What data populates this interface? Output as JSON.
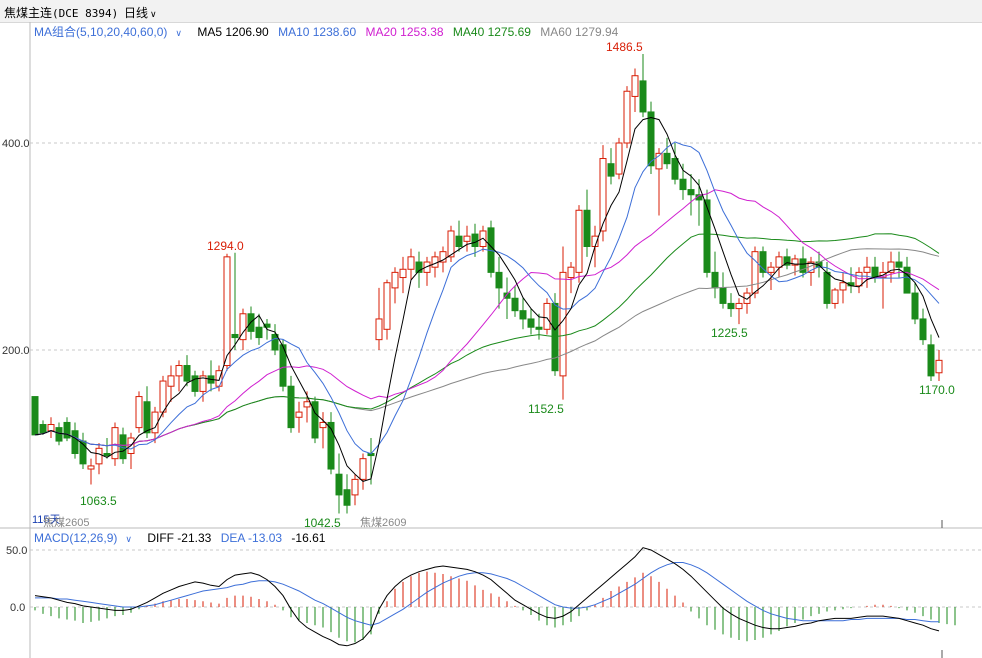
{
  "title_bar": {
    "symbol": "焦煤主连",
    "code": "(DCE 8394)",
    "period": "日线"
  },
  "ma_legend": {
    "group": "MA组合(5,10,20,40,60,0)",
    "ma5": "MA5 1206.90",
    "ma10": "MA10 1238.60",
    "ma20": "MA20 1253.38",
    "ma40": "MA40 1275.69",
    "ma60": "MA60 1279.94"
  },
  "macd_legend": {
    "group": "MACD(12,26,9)",
    "diff": "DIFF -21.33",
    "dea": "DEA -13.03",
    "macd": "-16.61"
  },
  "price_axis": {
    "label_1400": "400.0",
    "label_1200": "200.0"
  },
  "macd_axis": {
    "label_50": "50.0",
    "label_0": "0.0"
  },
  "contract_labels": {
    "left_prefix": "115天",
    "left": "焦煤2605",
    "right": "焦煤2609"
  },
  "annotations": {
    "high": "1486.5",
    "p1294": "1294.0",
    "p1063": "1063.5",
    "p1042": "1042.5",
    "p1152": "1152.5",
    "p1225": "1225.5",
    "p1170": "1170.0"
  },
  "colors": {
    "up": "#d81e06",
    "down": "#1a8a1a",
    "ma5": "#000000",
    "ma10": "#3d6fd8",
    "ma20": "#d020d0",
    "ma40": "#1a8a1a",
    "ma60": "#888888",
    "blue_text": "#3d6fd8"
  },
  "icons": {
    "dropdown": "chevron-down-icon"
  },
  "chart_data": {
    "type": "candlestick",
    "note": "Daily candles, approximate OHLC read from the chart",
    "ylim": [
      1030,
      1500
    ],
    "candles": [
      [
        1155,
        1150,
        1120,
        1118
      ],
      [
        1128,
        1132,
        1118,
        1120
      ],
      [
        1122,
        1135,
        1115,
        1128
      ],
      [
        1125,
        1130,
        1108,
        1112
      ],
      [
        1130,
        1135,
        1112,
        1115
      ],
      [
        1122,
        1130,
        1095,
        1100
      ],
      [
        1112,
        1120,
        1085,
        1090
      ],
      [
        1085,
        1095,
        1070,
        1088
      ],
      [
        1090,
        1110,
        1080,
        1105
      ],
      [
        1100,
        1115,
        1095,
        1098
      ],
      [
        1095,
        1130,
        1088,
        1125
      ],
      [
        1118,
        1125,
        1090,
        1095
      ],
      [
        1100,
        1120,
        1085,
        1115
      ],
      [
        1125,
        1160,
        1120,
        1155
      ],
      [
        1150,
        1165,
        1115,
        1120
      ],
      [
        1120,
        1145,
        1110,
        1140
      ],
      [
        1140,
        1175,
        1135,
        1170
      ],
      [
        1165,
        1185,
        1150,
        1175
      ],
      [
        1175,
        1190,
        1160,
        1185
      ],
      [
        1185,
        1195,
        1165,
        1170
      ],
      [
        1175,
        1180,
        1155,
        1160
      ],
      [
        1160,
        1180,
        1150,
        1175
      ],
      [
        1175,
        1190,
        1160,
        1168
      ],
      [
        1165,
        1185,
        1160,
        1180
      ],
      [
        1185,
        1293,
        1180,
        1290
      ],
      [
        1215,
        1294,
        1200,
        1212
      ],
      [
        1210,
        1240,
        1200,
        1235
      ],
      [
        1235,
        1242,
        1210,
        1218
      ],
      [
        1222,
        1235,
        1205,
        1212
      ],
      [
        1225,
        1230,
        1210,
        1222
      ],
      [
        1215,
        1225,
        1195,
        1200
      ],
      [
        1205,
        1210,
        1160,
        1165
      ],
      [
        1165,
        1175,
        1120,
        1125
      ],
      [
        1135,
        1150,
        1120,
        1140
      ],
      [
        1145,
        1160,
        1130,
        1150
      ],
      [
        1150,
        1155,
        1110,
        1115
      ],
      [
        1125,
        1140,
        1105,
        1130
      ],
      [
        1130,
        1140,
        1080,
        1085
      ],
      [
        1080,
        1100,
        1042,
        1060
      ],
      [
        1065,
        1080,
        1042,
        1050
      ],
      [
        1060,
        1080,
        1050,
        1075
      ],
      [
        1075,
        1100,
        1065,
        1095
      ],
      [
        1100,
        1115,
        1070,
        1098
      ],
      [
        1210,
        1260,
        1200,
        1230
      ],
      [
        1220,
        1268,
        1210,
        1265
      ],
      [
        1260,
        1280,
        1245,
        1275
      ],
      [
        1270,
        1290,
        1255,
        1278
      ],
      [
        1278,
        1298,
        1268,
        1290
      ],
      [
        1285,
        1295,
        1260,
        1275
      ],
      [
        1275,
        1290,
        1262,
        1285
      ],
      [
        1280,
        1295,
        1270,
        1290
      ],
      [
        1285,
        1300,
        1275,
        1295
      ],
      [
        1290,
        1320,
        1285,
        1315
      ],
      [
        1310,
        1325,
        1295,
        1300
      ],
      [
        1305,
        1320,
        1295,
        1310
      ],
      [
        1312,
        1322,
        1290,
        1300
      ],
      [
        1300,
        1320,
        1295,
        1315
      ],
      [
        1318,
        1325,
        1270,
        1275
      ],
      [
        1275,
        1290,
        1240,
        1260
      ],
      [
        1255,
        1270,
        1230,
        1250
      ],
      [
        1250,
        1262,
        1232,
        1238
      ],
      [
        1238,
        1250,
        1220,
        1230
      ],
      [
        1230,
        1240,
        1215,
        1222
      ],
      [
        1222,
        1235,
        1210,
        1220
      ],
      [
        1220,
        1250,
        1215,
        1245
      ],
      [
        1245,
        1255,
        1175,
        1180
      ],
      [
        1175,
        1300,
        1152,
        1275
      ],
      [
        1270,
        1285,
        1255,
        1280
      ],
      [
        1275,
        1340,
        1265,
        1335
      ],
      [
        1335,
        1355,
        1290,
        1300
      ],
      [
        1300,
        1320,
        1280,
        1310
      ],
      [
        1315,
        1398,
        1305,
        1385
      ],
      [
        1380,
        1395,
        1360,
        1368
      ],
      [
        1370,
        1405,
        1365,
        1400
      ],
      [
        1400,
        1455,
        1395,
        1450
      ],
      [
        1445,
        1472,
        1430,
        1465
      ],
      [
        1460,
        1486,
        1425,
        1430
      ],
      [
        1430,
        1440,
        1370,
        1378
      ],
      [
        1375,
        1395,
        1330,
        1390
      ],
      [
        1390,
        1405,
        1375,
        1380
      ],
      [
        1385,
        1400,
        1360,
        1365
      ],
      [
        1365,
        1380,
        1345,
        1355
      ],
      [
        1355,
        1370,
        1330,
        1350
      ],
      [
        1350,
        1365,
        1320,
        1345
      ],
      [
        1345,
        1355,
        1270,
        1275
      ],
      [
        1275,
        1295,
        1250,
        1260
      ],
      [
        1260,
        1275,
        1240,
        1245
      ],
      [
        1245,
        1255,
        1232,
        1240
      ],
      [
        1240,
        1250,
        1225,
        1245
      ],
      [
        1245,
        1260,
        1235,
        1255
      ],
      [
        1255,
        1300,
        1250,
        1295
      ],
      [
        1295,
        1300,
        1270,
        1275
      ],
      [
        1275,
        1285,
        1258,
        1280
      ],
      [
        1280,
        1295,
        1270,
        1290
      ],
      [
        1290,
        1298,
        1278,
        1282
      ],
      [
        1282,
        1292,
        1272,
        1288
      ],
      [
        1288,
        1300,
        1270,
        1275
      ],
      [
        1275,
        1290,
        1262,
        1285
      ],
      [
        1285,
        1295,
        1270,
        1280
      ],
      [
        1275,
        1285,
        1240,
        1245
      ],
      [
        1245,
        1260,
        1240,
        1258
      ],
      [
        1258,
        1275,
        1245,
        1265
      ],
      [
        1265,
        1280,
        1255,
        1262
      ],
      [
        1262,
        1280,
        1255,
        1275
      ],
      [
        1275,
        1290,
        1260,
        1280
      ],
      [
        1280,
        1290,
        1265,
        1270
      ],
      [
        1270,
        1285,
        1240,
        1275
      ],
      [
        1275,
        1295,
        1265,
        1285
      ],
      [
        1285,
        1295,
        1270,
        1280
      ],
      [
        1280,
        1290,
        1260,
        1255
      ],
      [
        1255,
        1265,
        1225,
        1230
      ],
      [
        1230,
        1240,
        1205,
        1210
      ],
      [
        1205,
        1215,
        1170,
        1175
      ],
      [
        1178,
        1200,
        1170,
        1190
      ]
    ],
    "macd": {
      "ylim": [
        -45,
        60
      ],
      "hist": [
        -3,
        -6,
        -8,
        -10,
        -11,
        -12,
        -14,
        -13,
        -12,
        -10,
        -8,
        -7,
        -5,
        -2,
        1,
        3,
        5,
        6,
        7,
        7,
        6,
        5,
        4,
        3,
        8,
        10,
        10,
        9,
        7,
        5,
        2,
        -3,
        -9,
        -12,
        -14,
        -16,
        -18,
        -22,
        -27,
        -30,
        -31,
        -29,
        -24,
        -6,
        5,
        16,
        22,
        27,
        30,
        31,
        30,
        29,
        27,
        25,
        23,
        19,
        15,
        12,
        9,
        5,
        1,
        -3,
        -7,
        -12,
        -16,
        -18,
        -16,
        -13,
        -8,
        -3,
        2,
        8,
        14,
        18,
        22,
        26,
        30,
        27,
        22,
        16,
        10,
        4,
        -4,
        -10,
        -16,
        -20,
        -24,
        -27,
        -29,
        -30,
        -29,
        -27,
        -24,
        -21,
        -17,
        -14,
        -11,
        -8,
        -6,
        -4,
        -3,
        -2,
        -1,
        0,
        1,
        2,
        2,
        1,
        -1,
        -3,
        -5,
        -8,
        -11,
        -14,
        -15,
        -16
      ],
      "diff": [
        10,
        9,
        8,
        6,
        4,
        3,
        1,
        0,
        -1,
        -2,
        -3,
        -3,
        -2,
        1,
        4,
        8,
        12,
        15,
        18,
        20,
        22,
        21,
        19,
        18,
        24,
        28,
        29,
        30,
        28,
        24,
        18,
        10,
        -2,
        -12,
        -18,
        -22,
        -26,
        -29,
        -33,
        -34,
        -32,
        -28,
        -20,
        -2,
        10,
        18,
        24,
        28,
        31,
        33,
        35,
        36,
        35,
        34,
        33,
        31,
        28,
        24,
        18,
        12,
        6,
        2,
        -2,
        -6,
        -9,
        -10,
        -8,
        -4,
        2,
        8,
        14,
        20,
        26,
        32,
        38,
        44,
        52,
        50,
        46,
        42,
        38,
        33,
        27,
        20,
        13,
        6,
        -1,
        -6,
        -10,
        -13,
        -16,
        -18,
        -19,
        -19,
        -18,
        -17,
        -15,
        -14,
        -12,
        -11,
        -10,
        -10,
        -10,
        -9,
        -8,
        -8,
        -8,
        -9,
        -10,
        -12,
        -14,
        -16,
        -19,
        -21
      ],
      "dea": [
        8,
        8,
        8,
        7,
        7,
        6,
        5,
        4,
        3,
        2,
        1,
        0,
        0,
        0,
        1,
        2,
        4,
        6,
        8,
        10,
        12,
        14,
        15,
        16,
        17,
        19,
        20,
        22,
        23,
        23,
        22,
        20,
        17,
        14,
        10,
        6,
        3,
        -1,
        -5,
        -9,
        -12,
        -14,
        -16,
        -14,
        -10,
        -6,
        -2,
        3,
        8,
        13,
        17,
        21,
        24,
        27,
        29,
        30,
        30,
        29,
        27,
        25,
        22,
        18,
        14,
        10,
        6,
        2,
        0,
        -1,
        -1,
        0,
        2,
        5,
        8,
        12,
        16,
        20,
        25,
        30,
        34,
        37,
        39,
        39,
        37,
        34,
        30,
        25,
        20,
        15,
        10,
        5,
        1,
        -3,
        -6,
        -8,
        -10,
        -11,
        -12,
        -12,
        -12,
        -12,
        -12,
        -12,
        -11,
        -11,
        -10,
        -10,
        -10,
        -10,
        -10,
        -11,
        -11,
        -12,
        -13,
        -13
      ]
    }
  }
}
